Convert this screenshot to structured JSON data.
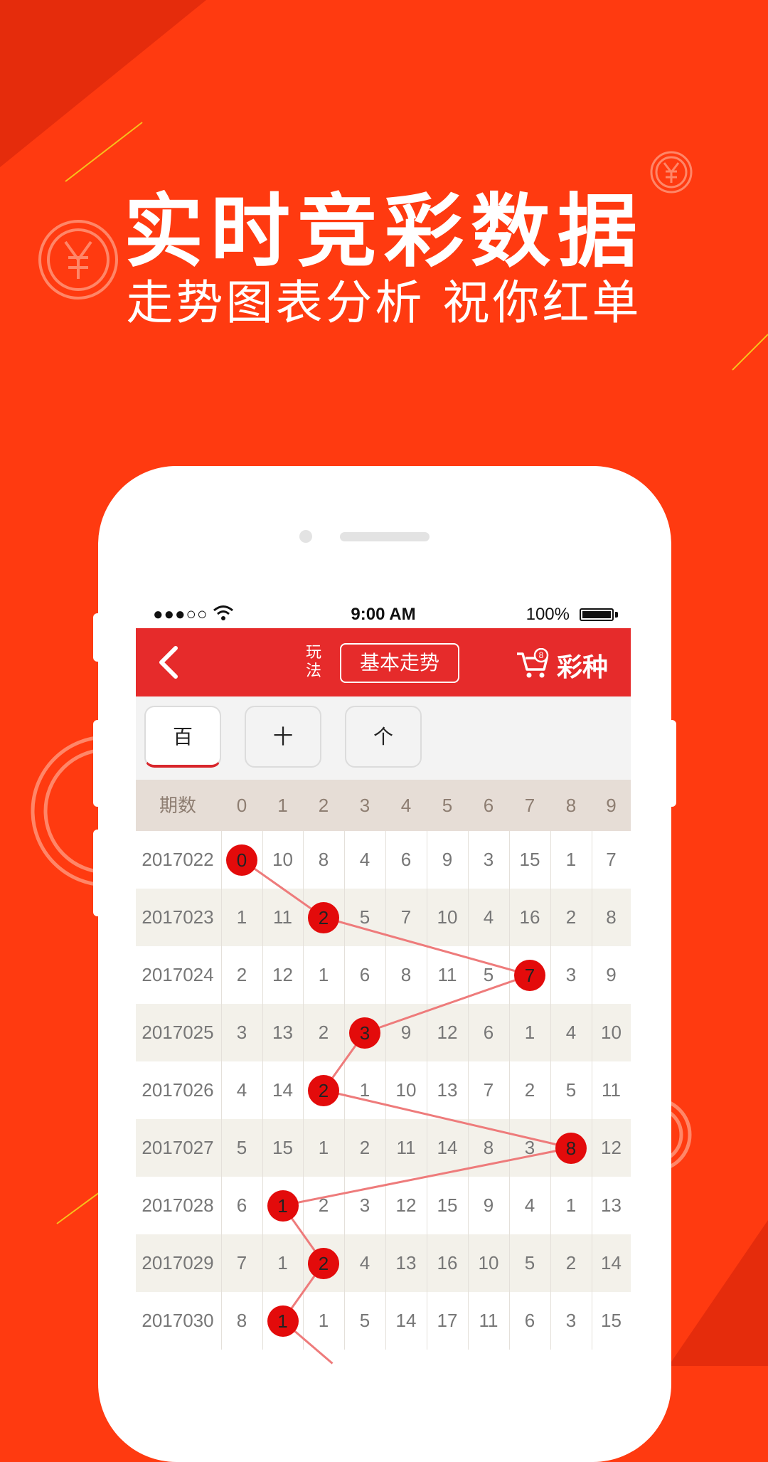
{
  "promo": {
    "headline": "实时竞彩数据",
    "subline": "走势图表分析 祝你红单"
  },
  "colors": {
    "background": "#FF3A10",
    "nav_bar": "#E62B2B",
    "ball": "#E30B0B",
    "trend_line": "#EE7B7B",
    "header_row": "#E6DDD6",
    "row_alt": "#F3F1EA"
  },
  "status_bar": {
    "signal": "●●●○○",
    "time": "9:00 AM",
    "battery": "100%"
  },
  "nav": {
    "back_icon": "chevron-left-icon",
    "wanfa_label": "玩\n法",
    "trend_label": "基本走势",
    "cart_icon": "cart-icon",
    "cart_badge": "8",
    "lottery_label": "彩种"
  },
  "digit_tabs": [
    {
      "label": "百",
      "active": true
    },
    {
      "label": "十",
      "active": false
    },
    {
      "label": "个",
      "active": false
    }
  ],
  "table": {
    "headers": [
      "期数",
      "0",
      "1",
      "2",
      "3",
      "4",
      "5",
      "6",
      "7",
      "8",
      "9"
    ],
    "rows": [
      {
        "period": "2017022",
        "values": [
          "0",
          "10",
          "8",
          "4",
          "6",
          "9",
          "3",
          "15",
          "1",
          "7"
        ],
        "hit": 0
      },
      {
        "period": "2017023",
        "values": [
          "1",
          "11",
          "2",
          "5",
          "7",
          "10",
          "4",
          "16",
          "2",
          "8"
        ],
        "hit": 2
      },
      {
        "period": "2017024",
        "values": [
          "2",
          "12",
          "1",
          "6",
          "8",
          "11",
          "5",
          "7",
          "3",
          "9"
        ],
        "hit": 7
      },
      {
        "period": "2017025",
        "values": [
          "3",
          "13",
          "2",
          "3",
          "9",
          "12",
          "6",
          "1",
          "4",
          "10"
        ],
        "hit": 3
      },
      {
        "period": "2017026",
        "values": [
          "4",
          "14",
          "2",
          "1",
          "10",
          "13",
          "7",
          "2",
          "5",
          "11"
        ],
        "hit": 2
      },
      {
        "period": "2017027",
        "values": [
          "5",
          "15",
          "1",
          "2",
          "11",
          "14",
          "8",
          "3",
          "8",
          "12"
        ],
        "hit": 8
      },
      {
        "period": "2017028",
        "values": [
          "6",
          "1",
          "2",
          "3",
          "12",
          "15",
          "9",
          "4",
          "1",
          "13"
        ],
        "hit": 1
      },
      {
        "period": "2017029",
        "values": [
          "7",
          "1",
          "2",
          "4",
          "13",
          "16",
          "10",
          "5",
          "2",
          "14"
        ],
        "hit": 2
      },
      {
        "period": "2017030",
        "values": [
          "8",
          "1",
          "1",
          "5",
          "14",
          "17",
          "11",
          "6",
          "3",
          "15"
        ],
        "hit": 1
      }
    ]
  }
}
